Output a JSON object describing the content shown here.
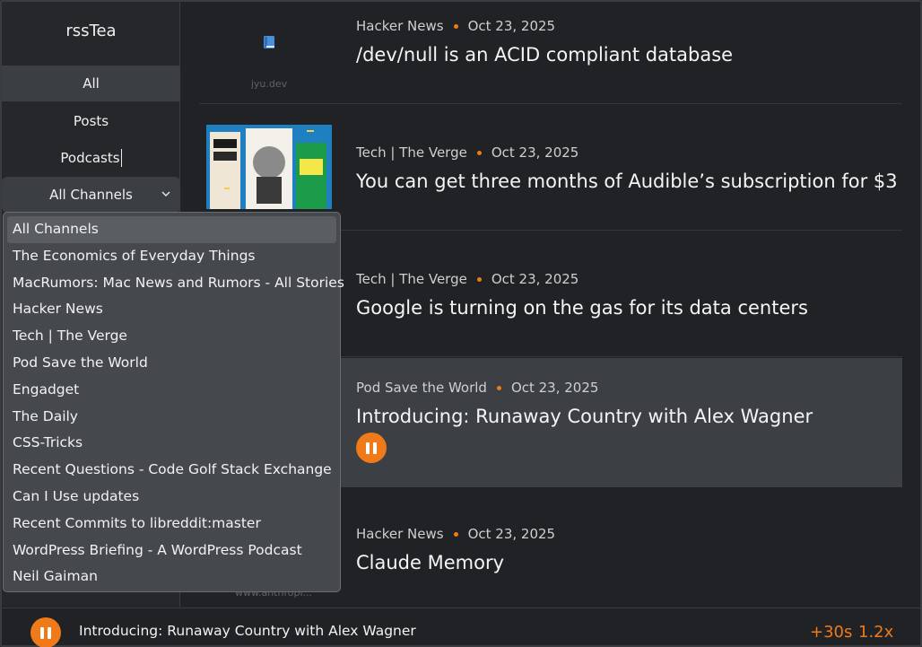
{
  "app": {
    "title": "rssTea"
  },
  "nav": {
    "items": [
      {
        "label": "All"
      },
      {
        "label": "Posts"
      },
      {
        "label": "Podcasts"
      }
    ]
  },
  "channel_select": {
    "value": "All Channels",
    "options": [
      "All Channels",
      "The Economics of Everyday Things",
      "MacRumors: Mac News and Rumors - All Stories",
      "Hacker News",
      "Tech | The Verge",
      "Pod Save the World",
      "Engadget",
      "The Daily",
      "CSS-Tricks",
      "Recent Questions - Code Golf Stack Exchange",
      "Can I Use updates",
      "Recent Commits to libreddit:master",
      "WordPress Briefing - A WordPress Podcast",
      "Neil Gaiman"
    ]
  },
  "feed": {
    "items": [
      {
        "source": "Hacker News",
        "date": "Oct 23, 2025",
        "title": "/dev/null is an ACID compliant database",
        "site": "jyu.dev",
        "thumb": "favicon"
      },
      {
        "source": "Tech | The Verge",
        "date": "Oct 23, 2025",
        "title": "You can get three months of Audible’s subscription for $3",
        "thumb": "books-image"
      },
      {
        "source": "Tech | The Verge",
        "date": "Oct 23, 2025",
        "title": "Google is turning on the gas for its data centers"
      },
      {
        "source": "Pod Save the World",
        "date": "Oct 23, 2025",
        "title": "Introducing: Runaway Country with Alex Wagner",
        "playing": true
      },
      {
        "source": "Hacker News",
        "date": "Oct 23, 2025",
        "title": "Claude Memory",
        "site": "www.anthropi..."
      }
    ]
  },
  "player": {
    "title": "Introducing: Runaway Country with Alex Wagner",
    "skip_label": "+30s",
    "speed_label": "1.2x"
  },
  "colors": {
    "accent": "#f07a1a",
    "background": "#202225",
    "sidebar": "#25272b",
    "highlight": "#3c3f44"
  }
}
